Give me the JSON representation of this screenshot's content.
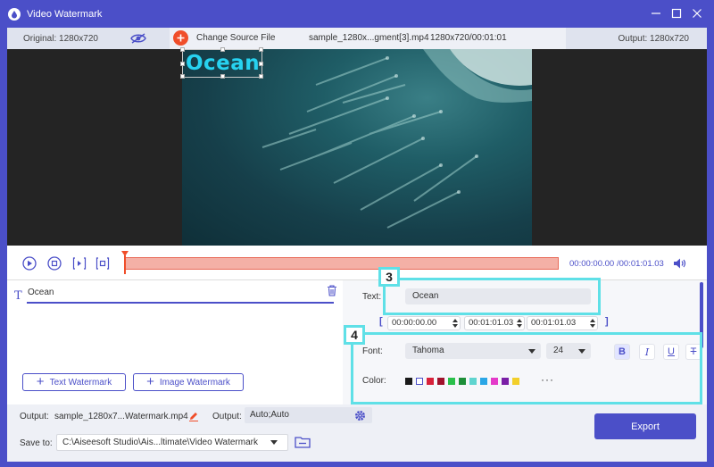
{
  "window": {
    "title": "Video Watermark",
    "minimize_icon": "minimize-icon",
    "maximize_icon": "maximize-icon",
    "close_icon": "close-icon"
  },
  "infobar": {
    "original": "Original: 1280x720",
    "change_source": "Change Source File",
    "file_name": "sample_1280x...gment[3].mp4",
    "file_info": "1280x720/00:01:01",
    "output": "Output: 1280x720"
  },
  "preview": {
    "watermark_text": "Ocean"
  },
  "timeline": {
    "current_time": "00:00:00.00",
    "total_time": "/00:01:01.03"
  },
  "watermark_list": {
    "items": [
      {
        "label": "Ocean"
      }
    ],
    "add_text_label": "Text Watermark",
    "add_image_label": "Image Watermark"
  },
  "properties": {
    "text_label": "Text:",
    "text_value": "Ocean",
    "start_time": "00:00:00.00",
    "end_time": "00:01:01.03",
    "duration": "00:01:01.03",
    "font_label": "Font:",
    "font_family": "Tahoma",
    "font_size": "24",
    "bold": "B",
    "italic": "I",
    "underline": "U",
    "strikethrough": "T",
    "color_label": "Color:",
    "swatches": [
      "#1a1a1a",
      "#ffffff",
      "#d8213a",
      "#a0112b",
      "#29c04a",
      "#1d8f38",
      "#5fd4cf",
      "#2aa6e6",
      "#e43ac9",
      "#7a1fa6",
      "#f2cf2a"
    ],
    "more": "···"
  },
  "callouts": {
    "text_step": "3",
    "font_step": "4"
  },
  "bottom": {
    "output_label": "Output:",
    "output_file": "sample_1280x7...Watermark.mp4",
    "output_format_label": "Output:",
    "output_format": "Auto;Auto",
    "save_label": "Save to:",
    "save_path": "C:\\Aiseesoft Studio\\Ais...ltimate\\Video Watermark",
    "export": "Export"
  },
  "colors": {
    "accent": "#4b4fc8",
    "watermark": "#27d2f0",
    "callout": "#5fe0e7",
    "add_button": "#f04e2a"
  }
}
